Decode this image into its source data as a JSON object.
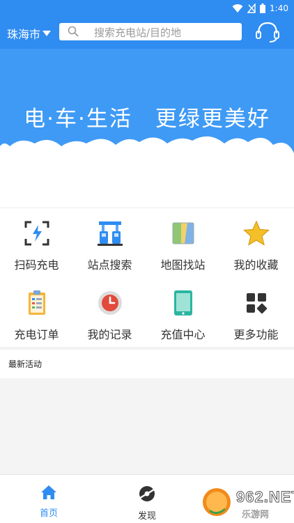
{
  "status_bar": {
    "time": "1:40"
  },
  "header": {
    "city": "珠海市",
    "search_placeholder": "搜索充电站/目的地"
  },
  "banner": {
    "slogan": "电·车·生活　更绿更美好"
  },
  "features": [
    {
      "label": "扫码充电",
      "icon": "scan-charge-icon"
    },
    {
      "label": "站点搜索",
      "icon": "station-search-icon"
    },
    {
      "label": "地图找站",
      "icon": "map-icon"
    },
    {
      "label": "我的收藏",
      "icon": "star-icon"
    },
    {
      "label": "充电订单",
      "icon": "clipboard-icon"
    },
    {
      "label": "我的记录",
      "icon": "clock-icon"
    },
    {
      "label": "充值中心",
      "icon": "tablet-icon"
    },
    {
      "label": "更多功能",
      "icon": "more-grid-icon"
    }
  ],
  "section": {
    "latest_activity": "最新活动"
  },
  "bottom_nav": [
    {
      "label": "首页",
      "icon": "home-icon",
      "active": true
    },
    {
      "label": "发现",
      "icon": "discover-icon",
      "active": false
    }
  ],
  "watermark": {
    "text": "962.NET",
    "sub": "乐游网"
  },
  "colors": {
    "primary": "#2f8cf1",
    "header_blue": "#2f8cf1",
    "banner_blue": "#3f9af5"
  }
}
